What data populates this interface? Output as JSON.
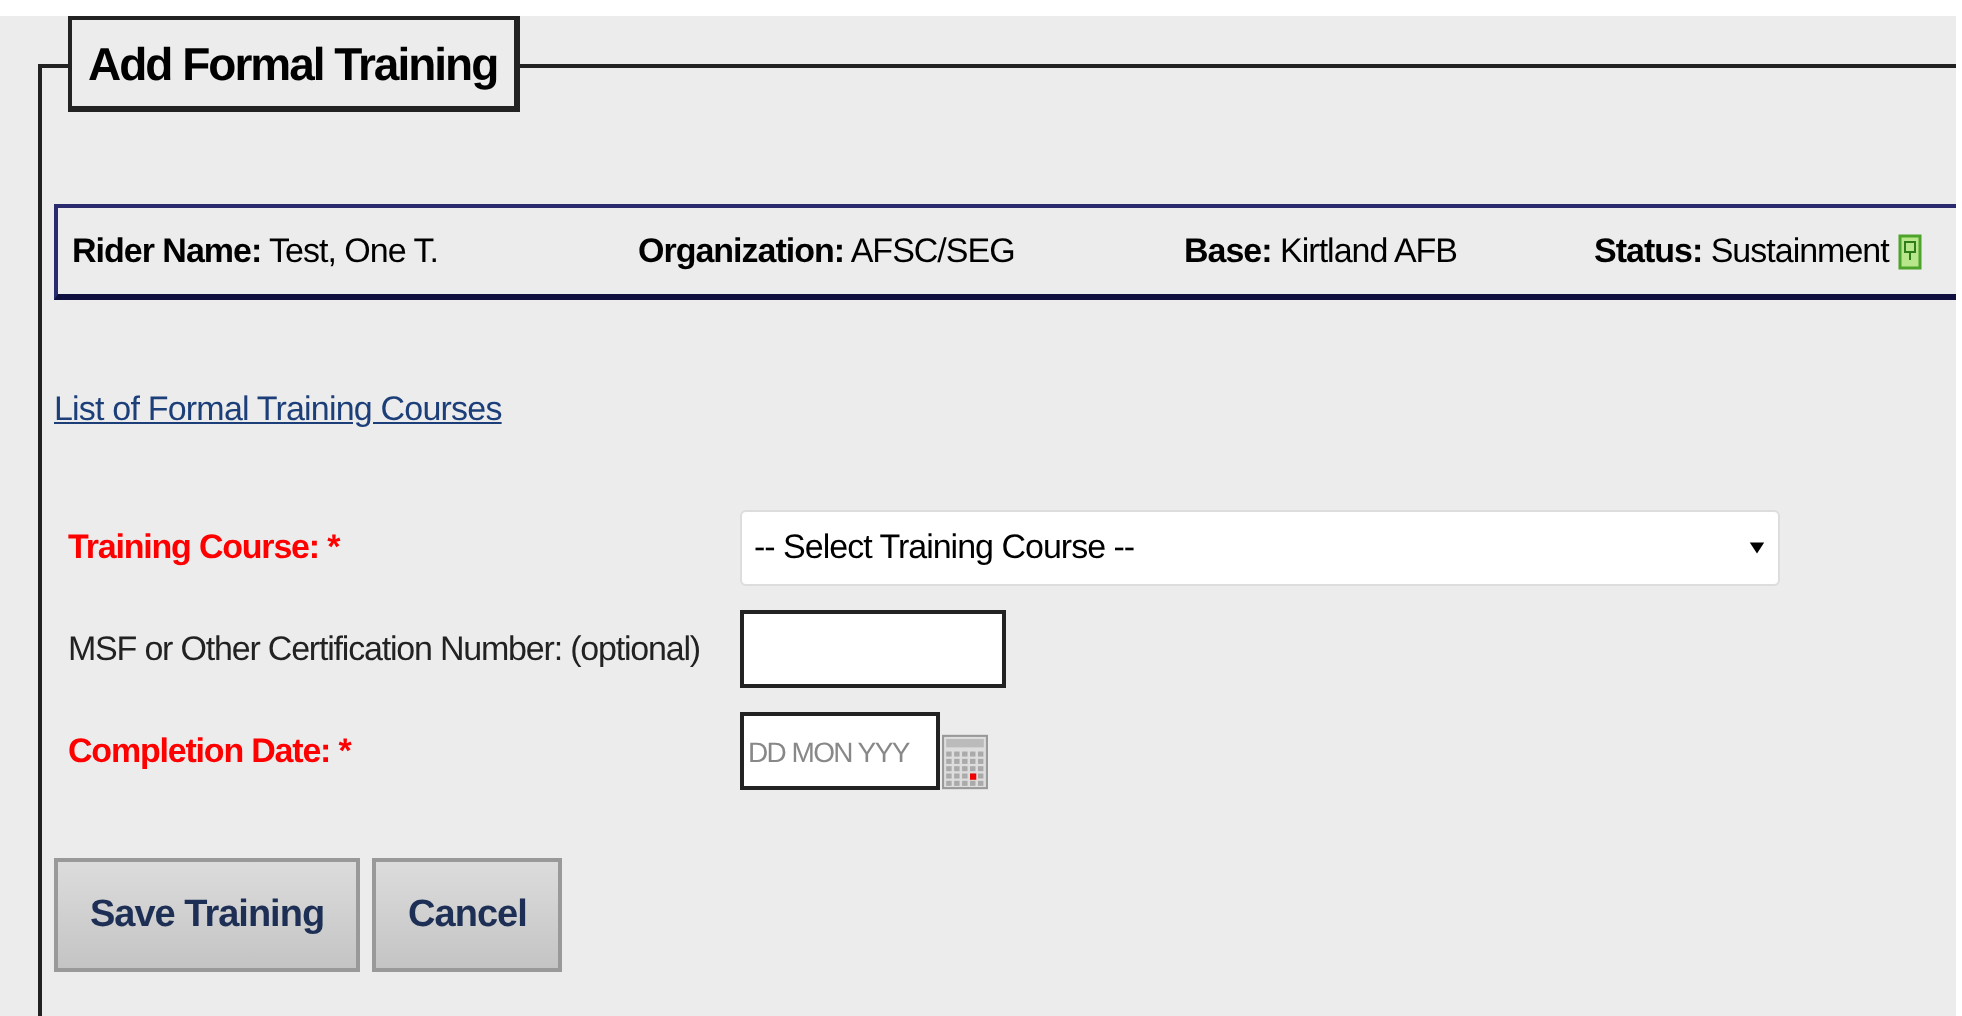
{
  "title": "Add Formal Training",
  "info": [
    {
      "kind": "field",
      "label": "Rider Name:",
      "value": "Test, One T."
    },
    {
      "kind": "field",
      "label": "Organization:",
      "value": "AFSC/SEG"
    },
    {
      "kind": "field",
      "label": "Base:",
      "value": "Kirtland AFB"
    },
    {
      "kind": "status",
      "label": "Status:",
      "value": "Sustainment"
    }
  ],
  "link": "List of Formal Training Courses",
  "fields": [
    {
      "kind": "select",
      "label": "Training Course: *",
      "required": true,
      "value": "-- Select Training Course --"
    },
    {
      "kind": "text",
      "label": "MSF or Other Certification Number: (optional)",
      "required": false
    },
    {
      "kind": "date",
      "label": "Completion Date: *",
      "required": true,
      "placeholder": "DD MON YYY"
    }
  ],
  "buttons": [
    "Save Training",
    "Cancel"
  ]
}
